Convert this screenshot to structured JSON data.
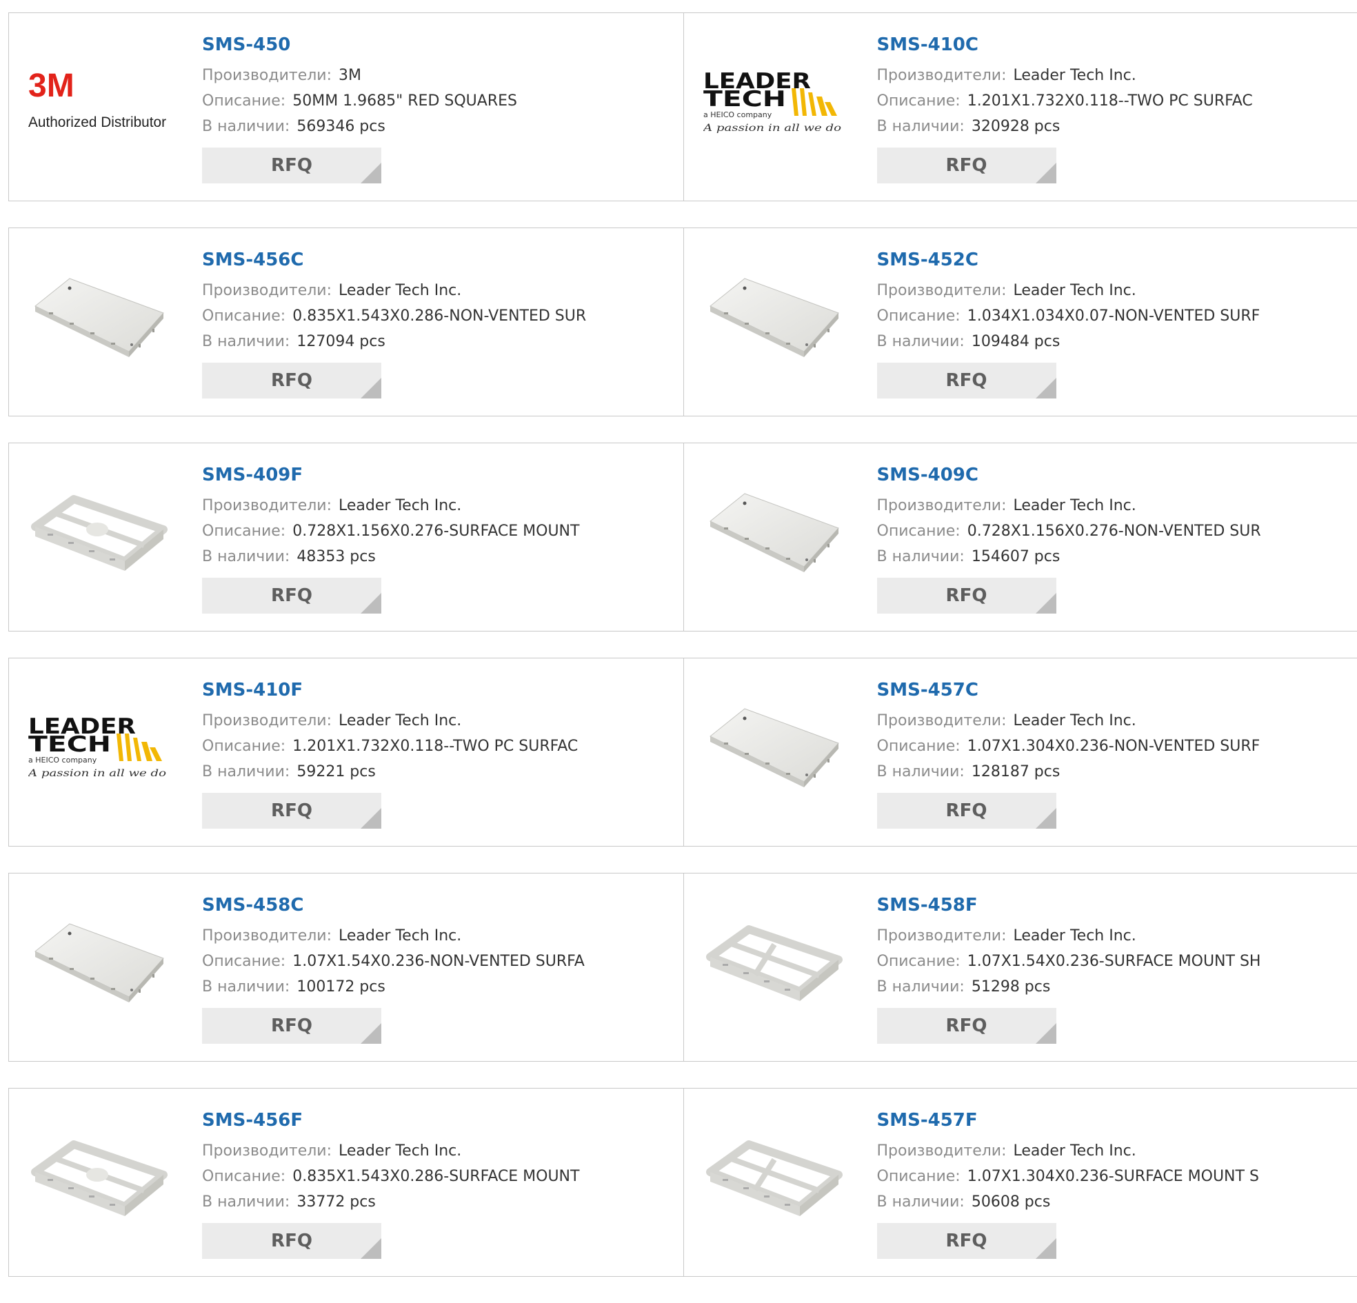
{
  "labels": {
    "manufacturer": "Производители:",
    "description": "Описание:",
    "stock": "В наличии:",
    "rfq": "RFQ"
  },
  "brand_logos": {
    "3m": {
      "mark": "3M",
      "caption": "Authorized Distributor",
      "mark_color": "#e2231a"
    },
    "leadertech": {
      "line1": "LEADER",
      "line2": "TECH",
      "sub": "a HEICO company",
      "tagline": "A passion in all we do",
      "accent": "#f2b705"
    }
  },
  "products": [
    {
      "part": "SMS-450",
      "manufacturer": "3M",
      "description": "50MM 1.9685\" RED SQUARES",
      "stock": "569346 pcs",
      "image": "logo-3m"
    },
    {
      "part": "SMS-410C",
      "manufacturer": "Leader Tech Inc.",
      "description": "1.201X1.732X0.118--TWO PC SURFAC",
      "stock": "320928 pcs",
      "image": "logo-leadertech"
    },
    {
      "part": "SMS-456C",
      "manufacturer": "Leader Tech Inc.",
      "description": "0.835X1.543X0.286-NON-VENTED SUR",
      "stock": "127094 pcs",
      "image": "shield-cover-long"
    },
    {
      "part": "SMS-452C",
      "manufacturer": "Leader Tech Inc.",
      "description": "1.034X1.034X0.07-NON-VENTED SURF",
      "stock": "109484 pcs",
      "image": "shield-cover-square"
    },
    {
      "part": "SMS-409F",
      "manufacturer": "Leader Tech Inc.",
      "description": "0.728X1.156X0.276-SURFACE MOUNT",
      "stock": "48353 pcs",
      "image": "shield-frame"
    },
    {
      "part": "SMS-409C",
      "manufacturer": "Leader Tech Inc.",
      "description": "0.728X1.156X0.276-NON-VENTED SUR",
      "stock": "154607 pcs",
      "image": "shield-cover"
    },
    {
      "part": "SMS-410F",
      "manufacturer": "Leader Tech Inc.",
      "description": "1.201X1.732X0.118--TWO PC SURFAC",
      "stock": "59221 pcs",
      "image": "logo-leadertech"
    },
    {
      "part": "SMS-457C",
      "manufacturer": "Leader Tech Inc.",
      "description": "1.07X1.304X0.236-NON-VENTED SURF",
      "stock": "128187 pcs",
      "image": "shield-cover"
    },
    {
      "part": "SMS-458C",
      "manufacturer": "Leader Tech Inc.",
      "description": "1.07X1.54X0.236-NON-VENTED SURFA",
      "stock": "100172 pcs",
      "image": "shield-cover-long"
    },
    {
      "part": "SMS-458F",
      "manufacturer": "Leader Tech Inc.",
      "description": "1.07X1.54X0.236-SURFACE MOUNT SH",
      "stock": "51298 pcs",
      "image": "shield-frame-quad"
    },
    {
      "part": "SMS-456F",
      "manufacturer": "Leader Tech Inc.",
      "description": "0.835X1.543X0.286-SURFACE MOUNT",
      "stock": "33772 pcs",
      "image": "shield-frame"
    },
    {
      "part": "SMS-457F",
      "manufacturer": "Leader Tech Inc.",
      "description": "1.07X1.304X0.236-SURFACE MOUNT S",
      "stock": "50608 pcs",
      "image": "shield-frame-quad"
    }
  ]
}
